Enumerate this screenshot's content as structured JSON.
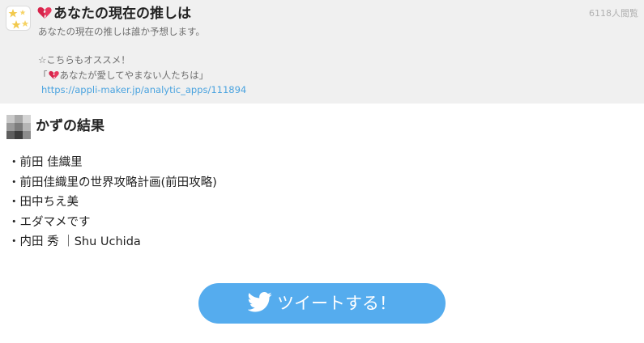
{
  "app": {
    "title": "あなたの現在の推しは",
    "view_count": "6118人閲覧",
    "description": "あなたの現在の推しは誰か予想します。",
    "recommend_heading": "☆こちらもオススメ！",
    "recommend_prefix": "「",
    "recommend_title": "あなたが愛してやまない人たちは",
    "recommend_suffix": "」",
    "recommend_url": "https://appli-maker.jp/analytic_apps/111894"
  },
  "result": {
    "title": "かずの結果",
    "items": [
      "・前田 佳織里",
      "・前田佳織里の世界攻略計画(前田攻略)",
      "・田中ちえ美",
      "・エダマメです",
      "・内田 秀 ｜Shu Uchida"
    ]
  },
  "tweet": {
    "label": "ツイートする！",
    "icon": "twitter-bird-icon",
    "color": "#55acee"
  },
  "icons": {
    "heart": "broken-heart-icon",
    "app_icon": "stars-icon",
    "avatar": "pixelated-avatar"
  }
}
